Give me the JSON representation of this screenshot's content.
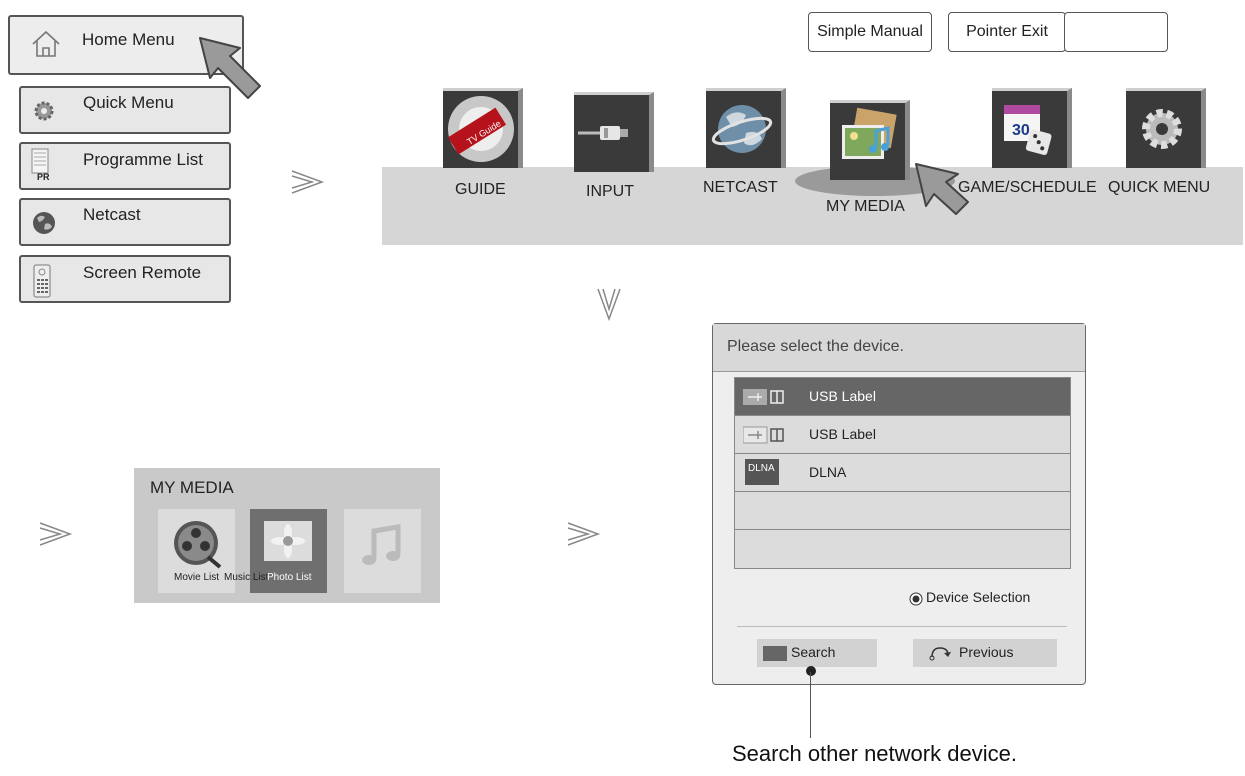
{
  "left_menu": {
    "items": [
      {
        "label": "Home Menu",
        "icon": "home-icon"
      },
      {
        "label": "Quick Menu",
        "icon": "gear-icon"
      },
      {
        "label": "Programme List",
        "icon": "programme-list-icon",
        "badge": "PR"
      },
      {
        "label": "Netcast",
        "icon": "globe-icon"
      },
      {
        "label": "Screen Remote",
        "icon": "remote-icon"
      }
    ]
  },
  "top_buttons": {
    "simple_manual": "Simple Manual",
    "pointer_exit": "Pointer Exit",
    "blank": ""
  },
  "launcher": {
    "items": [
      {
        "label": "GUIDE",
        "icon": "tv-guide-icon",
        "thumb_text": "TV Guide"
      },
      {
        "label": "INPUT",
        "icon": "input-cable-icon"
      },
      {
        "label": "NETCAST",
        "icon": "globe-icon"
      },
      {
        "label": "MY MEDIA",
        "icon": "my-media-icon"
      },
      {
        "label": "GAME/SCHEDULE",
        "icon": "calendar-icon",
        "thumb_text": "30"
      },
      {
        "label": "QUICK MENU",
        "icon": "gear-icon"
      }
    ]
  },
  "my_media": {
    "title": "MY MEDIA",
    "items": [
      {
        "caption": "Movie List",
        "icon": "film-reel-icon"
      },
      {
        "caption": "Music List",
        "icon": "music-note-icon"
      },
      {
        "caption": "Photo List",
        "icon": "photo-icon",
        "selected": true
      }
    ]
  },
  "device_dialog": {
    "title": "Please select the device.",
    "rows": [
      {
        "label": "USB Label",
        "icon": "usb-icon",
        "selected": true
      },
      {
        "label": "USB Label",
        "icon": "usb-icon"
      },
      {
        "label": "DLNA",
        "icon": "dlna-icon",
        "badge": "DLNA"
      },
      {
        "label": ""
      },
      {
        "label": ""
      }
    ],
    "device_selection": "Device Selection",
    "search": "Search",
    "previous": "Previous"
  },
  "callout": "Search other network device.",
  "colors": {
    "bar": "#d6d6d6",
    "tile": "#3a3a3a",
    "selected_row": "#666666"
  }
}
